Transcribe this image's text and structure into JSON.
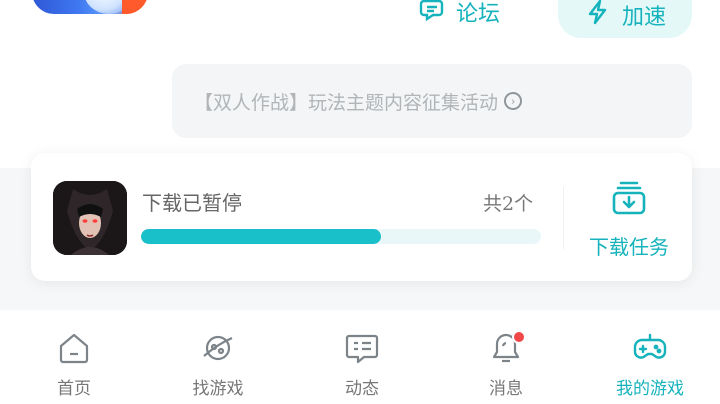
{
  "header": {
    "forum_label": "论坛",
    "boost_label": "加速"
  },
  "notice": {
    "text": "【双人作战】玩法主题内容征集活动"
  },
  "download": {
    "status": "下载已暂停",
    "count": "共2个",
    "progress": 0.6,
    "tasks_label": "下载任务"
  },
  "nav": {
    "items": [
      {
        "label": "首页",
        "icon": "home-icon"
      },
      {
        "label": "找游戏",
        "icon": "planet-icon"
      },
      {
        "label": "动态",
        "icon": "feed-icon"
      },
      {
        "label": "消息",
        "icon": "bell-icon"
      },
      {
        "label": "我的游戏",
        "icon": "gamepad-icon"
      }
    ]
  },
  "colors": {
    "accent": "#16b3bd",
    "progress": "#19bfc9",
    "badge": "#f04848"
  }
}
